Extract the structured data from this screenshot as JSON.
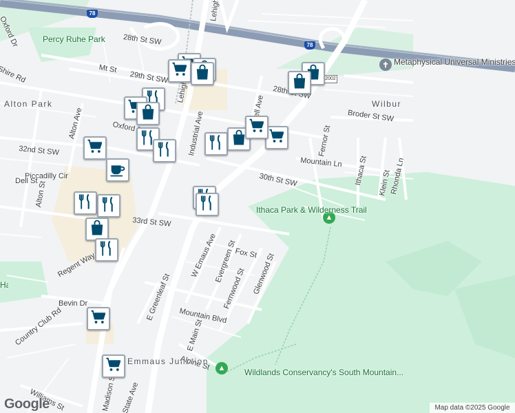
{
  "map": {
    "highways": [
      {
        "name": "78",
        "label": "78"
      }
    ],
    "routes": [
      {
        "label": "2002"
      }
    ],
    "streets": [
      "Oxford Dr",
      "Percy Ruhe Park",
      "28th St SW",
      "Mt St",
      "29th St SW",
      "Alton Park",
      "Alton Ave",
      "Oxford Dr",
      "32nd St SW",
      "Piccadilly Cir",
      "Dell St",
      "Alton St",
      "Industrial Ave",
      "Lehigh",
      "Lehigh St",
      "33rd St SW",
      "W Emaus Ave",
      "Regent Way",
      "Bevin Dr",
      "Country Club Rd",
      "E Greenleaf St",
      "Mountain Blvd",
      "E Main St",
      "Emmaus Junction",
      "Alpine St",
      "Williams St",
      "Wilbur",
      "Broder St SW",
      "Mountain Ln",
      "Fernor St",
      "Ithaca St",
      "Klein St",
      "Rhonda Ln",
      "30th St SW",
      "Evergreen St",
      "Fox St",
      "Fernwood St",
      "Glenwood St",
      "Shire Rd",
      "Hampshire Park",
      "State Ave",
      "Madison St",
      "Bell Ave",
      "28th St SW"
    ],
    "pois": [
      {
        "name": "Metaphysical Universal Ministries",
        "icon": "church-icon"
      },
      {
        "name": "Ithaca Park & Wilderness Trail",
        "icon": "tree-icon"
      },
      {
        "name": "Wildlands Conservancy's South Mountain...",
        "icon": "tree-icon"
      }
    ],
    "markers": [
      {
        "type": "cart-icon"
      },
      {
        "type": "bag-icon"
      },
      {
        "type": "cart-icon"
      },
      {
        "type": "bag-icon"
      },
      {
        "type": "fork-knife-icon"
      },
      {
        "type": "cart-icon"
      },
      {
        "type": "bag-icon"
      },
      {
        "type": "fork-knife-icon"
      },
      {
        "type": "fork-knife-icon"
      },
      {
        "type": "cart-icon"
      },
      {
        "type": "coffee-icon"
      },
      {
        "type": "fork-knife-icon"
      },
      {
        "type": "fork-knife-icon"
      },
      {
        "type": "bag-icon"
      },
      {
        "type": "fork-knife-icon"
      },
      {
        "type": "cart-icon"
      },
      {
        "type": "cart-icon"
      },
      {
        "type": "cart-icon"
      },
      {
        "type": "fork-knife-icon"
      },
      {
        "type": "bag-icon"
      },
      {
        "type": "fork-knife-icon"
      },
      {
        "type": "cart-icon"
      },
      {
        "type": "fork-knife-icon"
      },
      {
        "type": "bag-icon"
      },
      {
        "type": "bag-icon"
      }
    ],
    "colors": {
      "pin_icon": "#004b6e",
      "highway": "#8c9cb4",
      "park": "#cdefdc",
      "commercial": "#f5eedd",
      "road": "#ffffff"
    },
    "attribution": "Map data ©2025 Google",
    "logo": "Google"
  }
}
